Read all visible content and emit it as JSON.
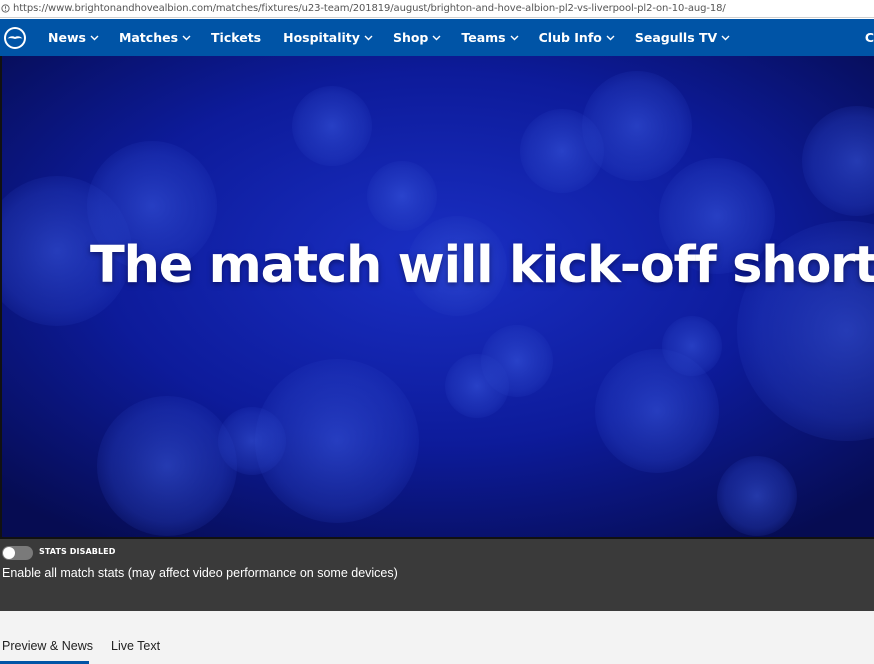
{
  "browser": {
    "url": "https://www.brightonandhovealbion.com/matches/fixtures/u23-team/201819/august/brighton-and-hove-albion-pl2-vs-liverpool-pl2-on-10-aug-18/"
  },
  "nav": {
    "brand_color": "#0054a6",
    "items": [
      {
        "label": "News",
        "has_dropdown": true
      },
      {
        "label": "Matches",
        "has_dropdown": true
      },
      {
        "label": "Tickets",
        "has_dropdown": false
      },
      {
        "label": "Hospitality",
        "has_dropdown": true
      },
      {
        "label": "Shop",
        "has_dropdown": true
      },
      {
        "label": "Teams",
        "has_dropdown": true
      },
      {
        "label": "Club Info",
        "has_dropdown": true
      },
      {
        "label": "Seagulls TV",
        "has_dropdown": true
      }
    ],
    "truncated_item": "C"
  },
  "video": {
    "headline": "The match will kick-off shortly",
    "background_color": "#0b1a8f"
  },
  "stats": {
    "status": "STATS DISABLED",
    "enabled": false,
    "description": "Enable all match stats (may affect video performance on some devices)"
  },
  "tabs": {
    "items": [
      "Preview & News",
      "Live Text"
    ],
    "active": "Preview & News"
  }
}
